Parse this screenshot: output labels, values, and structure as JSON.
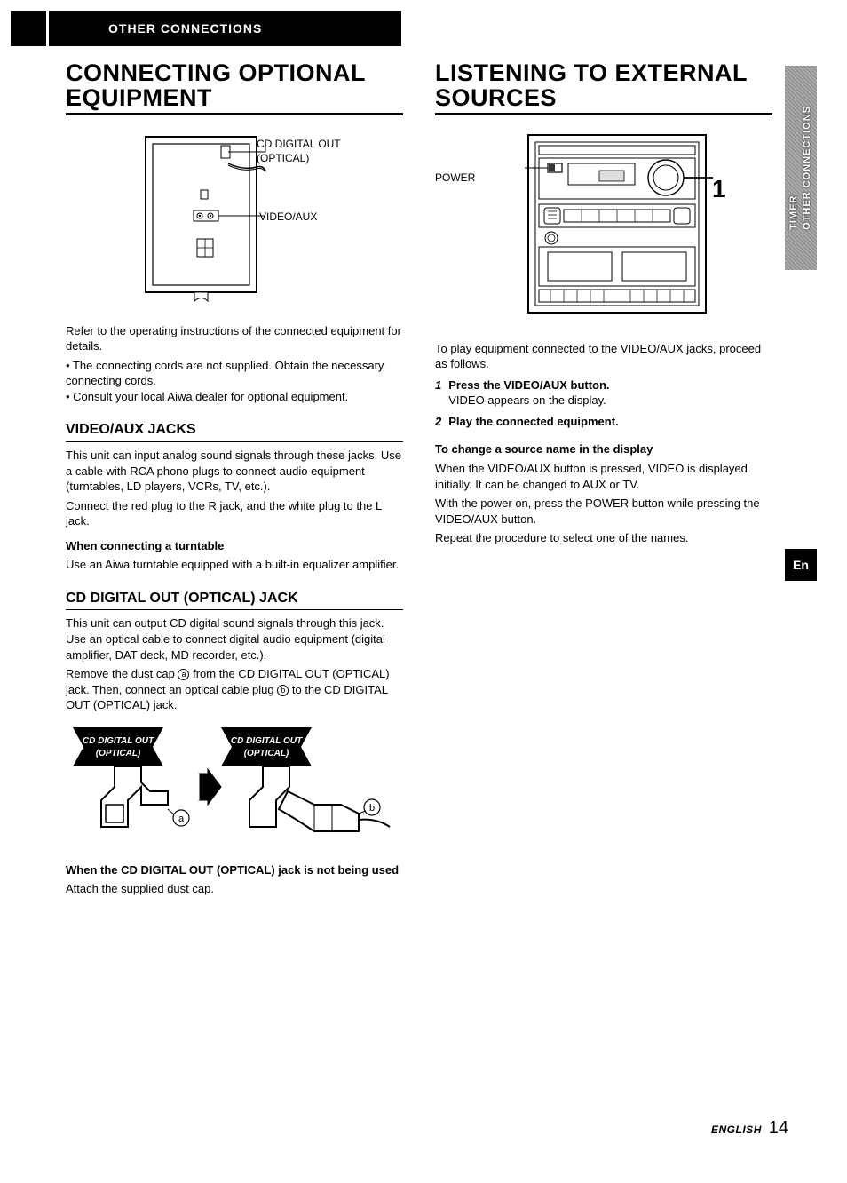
{
  "banner": "OTHER CONNECTIONS",
  "side_tab": "TIMER\nOTHER CONNECTIONS",
  "en_badge": "En",
  "footer": {
    "lang": "ENGLISH",
    "page": "14"
  },
  "left": {
    "title": "CONNECTING OPTIONAL EQUIPMENT",
    "fig1_labels": {
      "cd_out": "CD DIGITAL OUT\n(OPTICAL)",
      "video_aux": "VIDEO/AUX"
    },
    "intro_p": "Refer to the operating instructions of the connected equipment for details.",
    "bullets": [
      "The connecting cords are not supplied. Obtain the necessary connecting cords.",
      "Consult your local Aiwa dealer for optional equipment."
    ],
    "sec1_h": "VIDEO/AUX JACKS",
    "sec1_p1": "This unit can input analog sound signals through these jacks. Use a cable with RCA phono plugs to connect audio equipment (turntables, LD players, VCRs, TV, etc.).",
    "sec1_p2": "Connect the red plug to the R jack, and the white plug to the L jack.",
    "sec1_sub_h": "When connecting a turntable",
    "sec1_sub_p": "Use an Aiwa turntable equipped with a built-in equalizer amplifier.",
    "sec2_h": "CD DIGITAL OUT (OPTICAL) JACK",
    "sec2_p1": "This unit can output CD digital sound signals through this jack. Use an optical cable to connect digital audio equipment (digital amplifier, DAT deck, MD recorder, etc.).",
    "sec2_p2_a": "Remove the dust cap ",
    "sec2_p2_b": " from the CD DIGITAL OUT (OPTICAL) jack. Then, connect an optical cable plug ",
    "sec2_p2_c": " to the CD DIGITAL OUT (OPTICAL) jack.",
    "fig2_labels": {
      "left": "CD DIGITAL OUT\n(OPTICAL)",
      "right": "CD DIGITAL OUT\n(OPTICAL)",
      "a": "a",
      "b": "b"
    },
    "sec2_sub_h": "When the CD DIGITAL OUT (OPTICAL) jack is not being used",
    "sec2_sub_p": "Attach the supplied dust cap."
  },
  "right": {
    "title": "LISTENING TO EXTERNAL SOURCES",
    "fig_labels": {
      "power": "POWER",
      "one": "1"
    },
    "intro": "To play equipment connected to the VIDEO/AUX jacks, proceed as follows.",
    "steps": [
      {
        "n": "1",
        "bold": "Press the VIDEO/AUX button.",
        "sub": "VIDEO appears on the display."
      },
      {
        "n": "2",
        "bold": "Play the connected equipment.",
        "sub": ""
      }
    ],
    "change_h": "To change a source name in the display",
    "change_p1": "When the VIDEO/AUX button is pressed, VIDEO is displayed initially. It can be changed to AUX or TV.",
    "change_p2": "With the power on, press the POWER button while pressing the VIDEO/AUX button.",
    "change_p3": "Repeat the procedure to select one of the names."
  }
}
